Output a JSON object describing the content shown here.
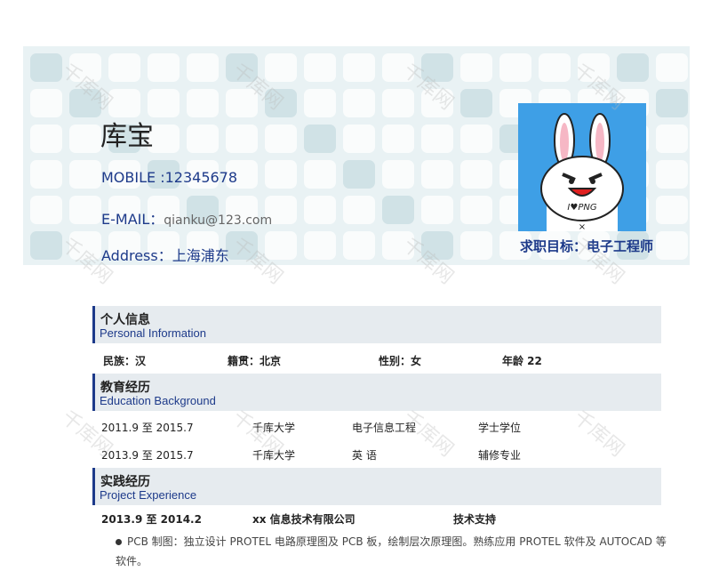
{
  "header": {
    "name": "库宝",
    "mobile_label": "MOBILE :",
    "mobile_value": "12345678",
    "email_label": "E-MAIL：",
    "email_value": "qianku@123.com",
    "address_label": "Address：",
    "address_value": "上海浦东",
    "goal": "求职目标：电子工程师",
    "photo_text": "I♥PNG"
  },
  "personal": {
    "title_zh": "个人信息",
    "title_en": "Personal Information",
    "fields": [
      "民族：汉",
      "籍贯：北京",
      "性别：女",
      "年龄  22"
    ]
  },
  "education": {
    "title_zh": "教育经历",
    "title_en": "Education Background",
    "rows": [
      [
        "2011.9 至 2015.7",
        "千库大学",
        "电子信息工程",
        "学士学位"
      ],
      [
        "2013.9 至 2015.7",
        "千库大学",
        "英  语",
        "辅修专业"
      ]
    ]
  },
  "project": {
    "title_zh": "实践经历",
    "title_en": "Project Experience",
    "row": [
      "2013.9 至 2014.2",
      "xx 信息技术有限公司",
      "技术支持"
    ],
    "bullet": "PCB 制图：独立设计 PROTEL 电路原理图及 PCB 板，绘制层次原理图。熟练应用 PROTEL 软件及 AUTOCAD 等软件。"
  },
  "watermark": "千库网",
  "colors": {
    "accent": "#1d3a8a",
    "photo_bg": "#3e9fe6",
    "section_bg": "#e6ebef",
    "header_bg": "#e9f2f4"
  }
}
